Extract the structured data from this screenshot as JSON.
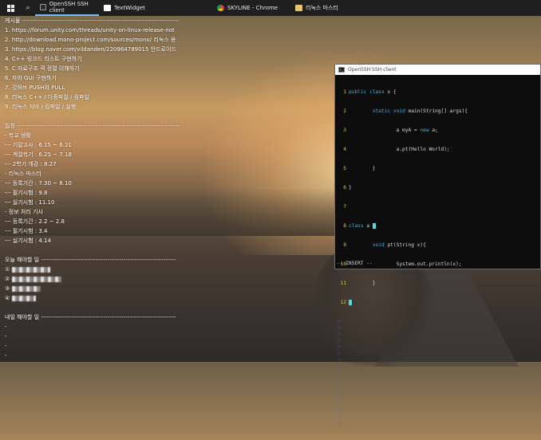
{
  "taskbar": {
    "apps": [
      {
        "label": "OpenSSH SSH client",
        "icon": "terminal-icon",
        "active": true
      },
      {
        "label": "TextWidget",
        "icon": "text-widget-icon",
        "active": false
      },
      {
        "label": "SKYLINE - Chrome",
        "icon": "chrome-icon",
        "active": false
      },
      {
        "label": "리눅스 마스터",
        "icon": "folder-icon",
        "active": false
      }
    ],
    "search_icon": "search-icon"
  },
  "notes": {
    "board_header": "게시물 ------------------------------------------------------------------------------",
    "board_items": [
      "1. https://forum.unity.com/threads/unity-on-linux-release-not",
      "2. http://download.mono-project.com/sources/mono/ 리눅스 용",
      "3. https://blog.naver.com/vildanden/220964789015 안드로이드 ",
      "4. C++ 링크드 리스트 구현하기",
      "5. C 자료구조 격 정렬 이해하기",
      "6. 자바 GUI 구현하기",
      "7. 깃허브 PUSH와 PULL",
      "8. 리눅스 C++ / 다중파일 / 컴파일",
      "9. 리눅스 자바 / 컴파일 / 실행"
    ],
    "schedule_header": "일정 ---------------------------------------------------------------------------------",
    "schedule_items": [
      "- 학교 생활",
      "--- 기말고사 : 6.15 ~ 6.21",
      "--- 계절학기 : 6.25 ~ 7.18",
      "--- 2학기 개강 : 8.27",
      "- 리눅스 마스터",
      "--- 등록기간 : 7.30 ~ 8.10",
      "--- 필기시험 : 9.8",
      "--- 실기시험 : 11.10",
      "- 정보 처리 기사",
      "--- 등록기간 : 2.2 ~ 2.8",
      "--- 필기시험 : 3.4",
      "--- 실기시험 : 4.14"
    ],
    "today_header": "오늘 해야할 일 -------------------------------------------------------------------",
    "today_items": [
      "①",
      "②",
      "③",
      "④"
    ],
    "tomorrow_header": "내일 해야할 일 -------------------------------------------------------------------",
    "tomorrow_items": [
      "-",
      "-",
      "-",
      "-"
    ]
  },
  "ssh": {
    "title": "OpenSSH SSH client",
    "lines": [
      {
        "n": "1",
        "text": "public class x {"
      },
      {
        "n": "2",
        "text": "        static void main(String[] args){"
      },
      {
        "n": "3",
        "text": "                a myA = new a;"
      },
      {
        "n": "4",
        "text": "                a.pt(Hello World);"
      },
      {
        "n": "5",
        "text": "        }"
      },
      {
        "n": "6",
        "text": "}"
      },
      {
        "n": "7",
        "text": ""
      },
      {
        "n": "8",
        "text": "class a "
      },
      {
        "n": "9",
        "text": "        void pt(String x){"
      },
      {
        "n": "10",
        "text": "                System.out.println(x);"
      },
      {
        "n": "11",
        "text": "        }"
      },
      {
        "n": "12",
        "text": ""
      }
    ],
    "tilde": "~",
    "status": "-- INSERT --"
  },
  "colors": {
    "taskbar_bg": "#1f1f1f",
    "terminal_bg": "#0c0c0c",
    "line_number": "#d7c844",
    "keyword": "#3ab7e6",
    "tilde": "#3a6bd8"
  }
}
